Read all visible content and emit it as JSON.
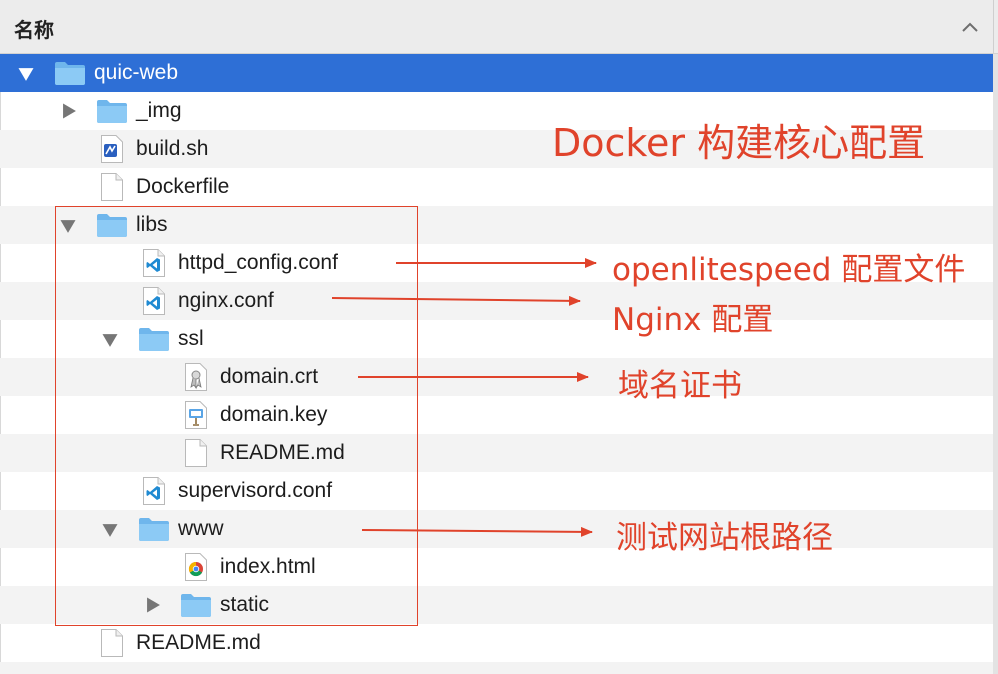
{
  "header": {
    "column_title": "名称"
  },
  "rows": [
    {
      "label": "quic-web"
    },
    {
      "label": "_img"
    },
    {
      "label": "build.sh"
    },
    {
      "label": "Dockerfile"
    },
    {
      "label": "libs"
    },
    {
      "label": "httpd_config.conf"
    },
    {
      "label": "nginx.conf"
    },
    {
      "label": "ssl"
    },
    {
      "label": "domain.crt"
    },
    {
      "label": "domain.key"
    },
    {
      "label": "README.md"
    },
    {
      "label": "supervisord.conf"
    },
    {
      "label": "www"
    },
    {
      "label": "index.html"
    },
    {
      "label": "static"
    },
    {
      "label": "README.md"
    }
  ],
  "annotations": {
    "docker": "Docker 构建核心配置",
    "openlitespeed": "openlitespeed 配置文件",
    "nginx": "Nginx 配置",
    "cert": "域名证书",
    "webroot": "测试网站根路径"
  },
  "colors": {
    "selection": "#2e6fd6",
    "annotation": "#e0432b",
    "folder": "#72b9ee"
  }
}
